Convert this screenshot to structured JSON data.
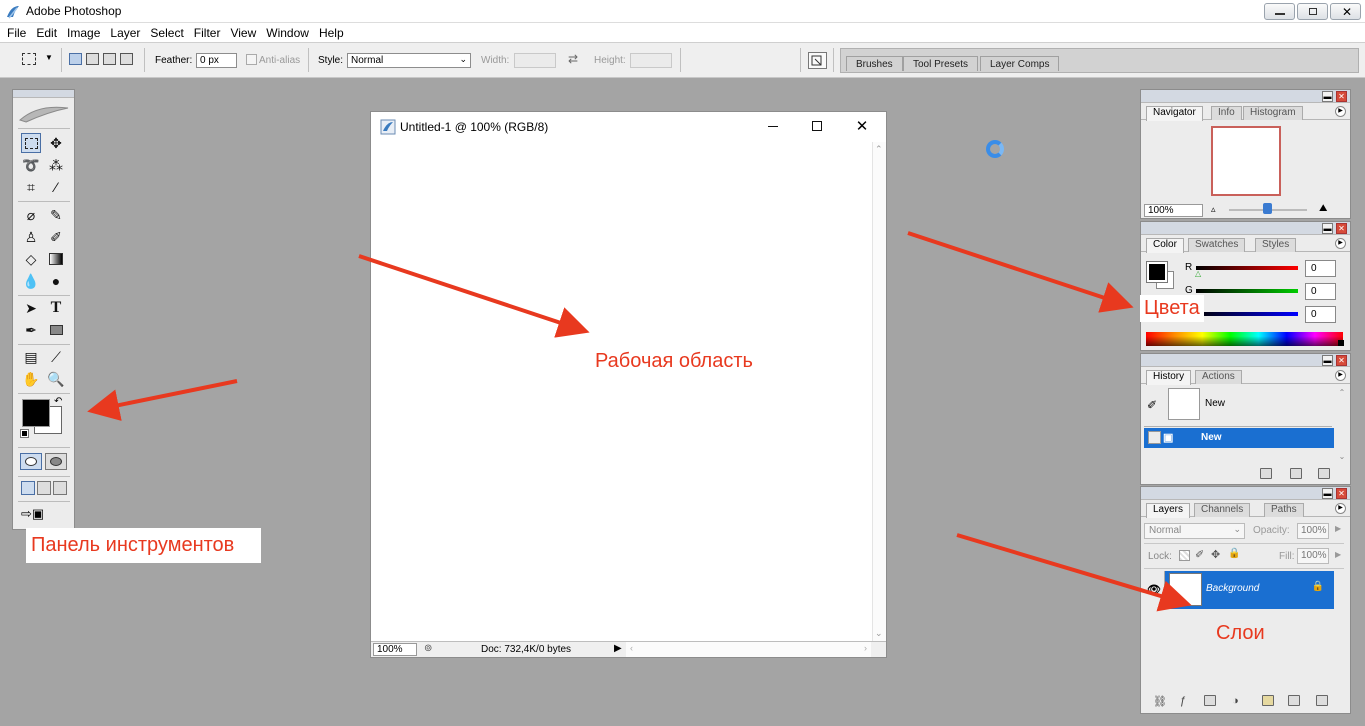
{
  "app": {
    "title": "Adobe Photoshop"
  },
  "menu": [
    "File",
    "Edit",
    "Image",
    "Layer",
    "Select",
    "Filter",
    "View",
    "Window",
    "Help"
  ],
  "options": {
    "feather_label": "Feather:",
    "feather_value": "0 px",
    "antialias_label": "Anti-alias",
    "style_label": "Style:",
    "style_value": "Normal",
    "width_label": "Width:",
    "height_label": "Height:"
  },
  "dock_tabs": [
    "Brushes",
    "Tool Presets",
    "Layer Comps"
  ],
  "document": {
    "title": "Untitled-1 @ 100% (RGB/8)",
    "zoom": "100%",
    "doc_info": "Doc: 732,4K/0 bytes"
  },
  "navigator": {
    "tabs": [
      "Navigator",
      "Info",
      "Histogram"
    ],
    "zoom": "100%"
  },
  "color_panel": {
    "tabs": [
      "Color",
      "Swatches",
      "Styles"
    ],
    "channels": [
      {
        "label": "R",
        "value": "0"
      },
      {
        "label": "G",
        "value": "0"
      },
      {
        "label": "B",
        "value": "0"
      }
    ]
  },
  "history": {
    "tabs": [
      "History",
      "Actions"
    ],
    "snapshot_label": "New",
    "items": [
      "New"
    ]
  },
  "layers": {
    "tabs": [
      "Layers",
      "Channels",
      "Paths"
    ],
    "blend_mode": "Normal",
    "opacity_label": "Opacity:",
    "opacity": "100%",
    "lock_label": "Lock:",
    "fill_label": "Fill:",
    "fill": "100%",
    "items": [
      "Background"
    ]
  },
  "annotations": {
    "workspace": "Рабочая область",
    "colors": "Цвета",
    "toolbar": "Панель инструментов",
    "layers": "Слои"
  },
  "colors": {
    "annotation": "#e8391f",
    "selection": "#1a6fd1"
  }
}
